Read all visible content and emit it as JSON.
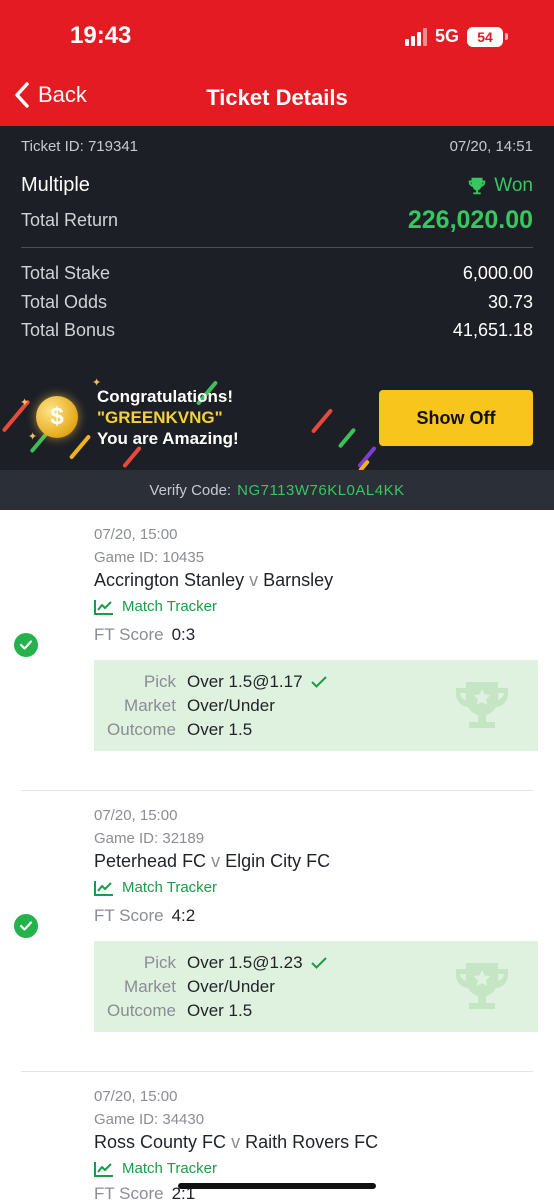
{
  "status_bar": {
    "time": "19:43",
    "network": "5G",
    "battery": "54"
  },
  "nav": {
    "back_label": "Back",
    "title": "Ticket Details"
  },
  "ticket": {
    "id": "Ticket ID: 719341",
    "date": "07/20, 14:51",
    "type": "Multiple",
    "status": "Won",
    "total_return_label": "Total Return",
    "total_return": "226,020.00",
    "stake_label": "Total Stake",
    "stake": "6,000.00",
    "odds_label": "Total Odds",
    "odds": "30.73",
    "bonus_label": "Total Bonus",
    "bonus": "41,651.18"
  },
  "banner": {
    "line1": "Congratulations!",
    "name": "\"GREENKVNG\"",
    "line3": "You are Amazing!",
    "button": "Show Off"
  },
  "verify": {
    "label": "Verify Code:",
    "code": "NG7113W76KL0AL4KK"
  },
  "labels": {
    "match_tracker": "Match Tracker",
    "ft_score": "FT Score",
    "pick": "Pick",
    "market": "Market",
    "outcome": "Outcome",
    "vs": "v"
  },
  "selections": [
    {
      "date": "07/20, 15:00",
      "game_id": "Game ID: 10435",
      "home": "Accrington Stanley",
      "away": "Barnsley",
      "score": "0:3",
      "pick": "Over 1.5@1.17",
      "market": "Over/Under",
      "outcome": "Over 1.5"
    },
    {
      "date": "07/20, 15:00",
      "game_id": "Game ID: 32189",
      "home": "Peterhead FC",
      "away": "Elgin City FC",
      "score": "4:2",
      "pick": "Over 1.5@1.23",
      "market": "Over/Under",
      "outcome": "Over 1.5"
    },
    {
      "date": "07/20, 15:00",
      "game_id": "Game ID: 34430",
      "home": "Ross County FC",
      "away": "Raith Rovers FC",
      "score": "2:1"
    }
  ],
  "colors": {
    "brand_red": "#e41b23",
    "win_green": "#36c75f",
    "dark_bg": "#1c1f26",
    "button_yellow": "#f8c51c"
  }
}
